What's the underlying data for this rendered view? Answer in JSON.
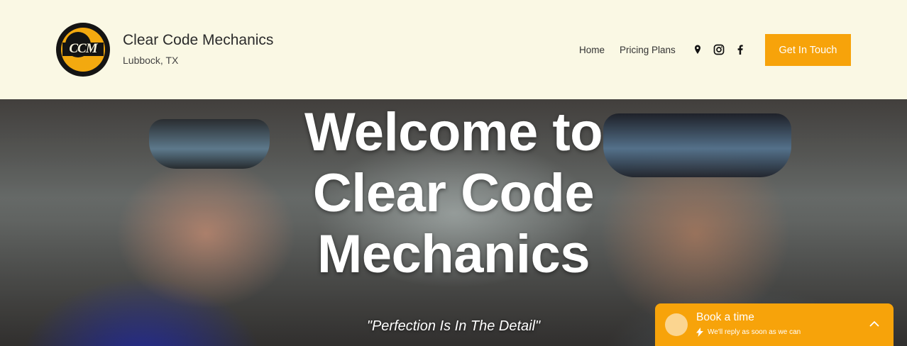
{
  "header": {
    "logo_text": "CCM",
    "title": "Clear Code Mechanics",
    "subtitle": "Lubbock, TX",
    "nav": [
      {
        "label": "Home"
      },
      {
        "label": "Pricing Plans"
      }
    ],
    "social_icons": [
      "map-pin-icon",
      "instagram-icon",
      "facebook-icon"
    ],
    "cta_label": "Get In Touch"
  },
  "hero": {
    "heading": "Welcome to Clear Code Mechanics",
    "tagline": "\"Perfection Is In The Detail\""
  },
  "chat_widget": {
    "title": "Book a time",
    "subtitle": "We'll reply as soon as we can"
  },
  "colors": {
    "background": "#faf8e4",
    "accent": "#f7a30a",
    "text": "#2b2b2b"
  }
}
